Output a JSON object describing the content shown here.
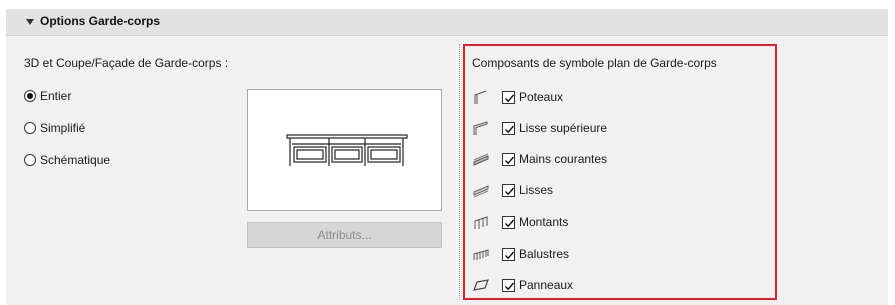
{
  "panel": {
    "title": "Options Garde-corps"
  },
  "left": {
    "title": "3D et Coupe/Façade de Garde-corps :",
    "options": [
      {
        "label": "Entier",
        "selected": true
      },
      {
        "label": "Simplifié",
        "selected": false
      },
      {
        "label": "Schématique",
        "selected": false
      }
    ],
    "attributes_button": "Attributs..."
  },
  "right": {
    "title": "Composants de symbole plan de Garde-corps",
    "items": [
      {
        "label": "Poteaux",
        "checked": true,
        "icon": "post-symbol-icon"
      },
      {
        "label": "Lisse supérieure",
        "checked": true,
        "icon": "top-rail-symbol-icon"
      },
      {
        "label": "Mains courantes",
        "checked": true,
        "icon": "handrail-symbol-icon"
      },
      {
        "label": "Lisses",
        "checked": true,
        "icon": "rail-symbol-icon"
      },
      {
        "label": "Montants",
        "checked": true,
        "icon": "inner-post-symbol-icon"
      },
      {
        "label": "Balustres",
        "checked": true,
        "icon": "baluster-symbol-icon"
      },
      {
        "label": "Panneaux",
        "checked": true,
        "icon": "panel-symbol-icon"
      }
    ]
  },
  "colors": {
    "highlight_border": "#e0222a",
    "panel_bg": "#f1f1f1",
    "header_bg": "#e2e2e2"
  }
}
